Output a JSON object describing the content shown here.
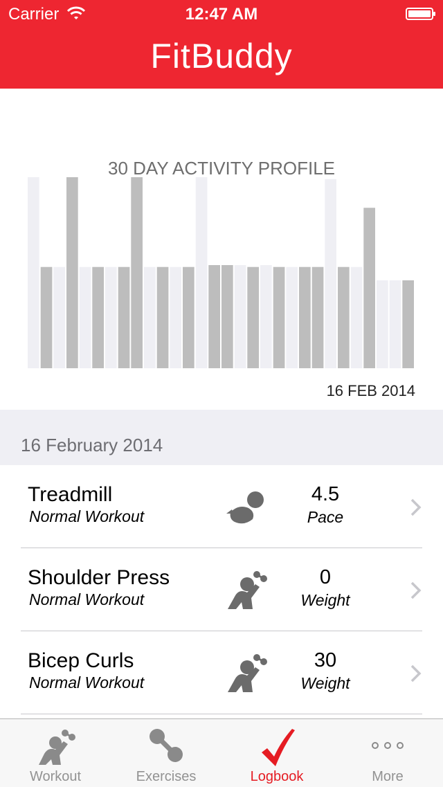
{
  "status_bar": {
    "carrier": "Carrier",
    "time": "12:47 AM"
  },
  "header": {
    "title": "FitBuddy"
  },
  "activity": {
    "title": "30 DAY ACTIVITY PROFILE",
    "date_label": "16 FEB 2014"
  },
  "chart_data": {
    "type": "bar",
    "title": "30 DAY ACTIVITY PROFILE",
    "values": [
      100,
      53,
      53,
      100,
      53,
      53,
      53,
      53,
      100,
      53,
      53,
      53,
      53,
      100,
      54,
      54,
      54,
      53,
      54,
      53,
      53,
      53,
      53,
      99,
      53,
      53,
      84,
      46,
      46,
      46
    ],
    "highlight": [
      false,
      true,
      false,
      true,
      false,
      true,
      false,
      true,
      true,
      false,
      true,
      false,
      true,
      false,
      true,
      true,
      false,
      true,
      false,
      true,
      false,
      true,
      true,
      false,
      true,
      false,
      true,
      false,
      false,
      true
    ],
    "colors": {
      "light": "#efeff4",
      "dark": "#bdbdbd"
    },
    "ylim": [
      0,
      100
    ],
    "grid": false,
    "xlabel": "",
    "ylabel": ""
  },
  "section": {
    "title": "16 February 2014"
  },
  "entries": [
    {
      "name": "Treadmill",
      "type": "Normal Workout",
      "value": "4.5",
      "unit": "Pace",
      "icon": "treadmill-icon"
    },
    {
      "name": "Shoulder Press",
      "type": "Normal Workout",
      "value": "0",
      "unit": "Weight",
      "icon": "weightlifter-icon"
    },
    {
      "name": "Bicep Curls",
      "type": "Normal Workout",
      "value": "30",
      "unit": "Weight",
      "icon": "weightlifter-icon"
    }
  ],
  "tabs": [
    {
      "label": "Workout",
      "icon": "workout-icon"
    },
    {
      "label": "Exercises",
      "icon": "dumbbell-icon"
    },
    {
      "label": "Logbook",
      "icon": "checkmark-icon",
      "active": true
    },
    {
      "label": "More",
      "icon": "more-icon"
    }
  ],
  "colors": {
    "brand": "#ee2631",
    "active_tab": "#e51c23",
    "inactive_tab": "#929292"
  }
}
